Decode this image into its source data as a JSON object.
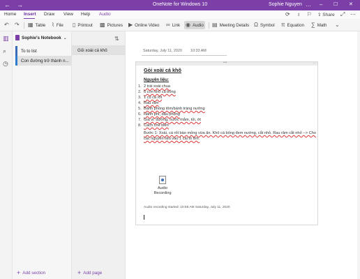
{
  "titlebar": {
    "back": "←",
    "forward": "→",
    "title": "OneNote for Windows 10",
    "user": "Sophie Nguyen",
    "more": "…",
    "minimize": "–",
    "maximize": "☐",
    "close": "✕"
  },
  "menu": {
    "tabs": [
      "Home",
      "Insert",
      "Draw",
      "View",
      "Help",
      "Audio"
    ],
    "active": "Insert",
    "share_label": "Share"
  },
  "ribbon": {
    "undo": "↶",
    "redo": "↷",
    "table": "Table",
    "file": "File",
    "printout": "Printout",
    "pictures": "Pictures",
    "online_video": "Online Video",
    "link": "Link",
    "audio": "Audio",
    "meeting_details": "Meeting Details",
    "symbol": "Symbol",
    "equation": "Equation",
    "math": "Math",
    "more": "⌄"
  },
  "notebook": {
    "name": "Sophie's Notebook",
    "sections": [
      {
        "label": "To to list",
        "color": "#3a6db5"
      },
      {
        "label": "Con đường trở thành n...",
        "color": "#2e7bd0"
      }
    ],
    "add_section": "Add section"
  },
  "pages": {
    "items": [
      "Gỏi xoài cá khô"
    ],
    "add_page": "Add page"
  },
  "page": {
    "date": "Saturday, July 11, 2020",
    "time": "10:33 AM",
    "title": "Gỏi xoài cá khô",
    "ingredients_heading": "Nguyên liệu:",
    "ingredients": [
      {
        "num": "1.",
        "text": "2 trái xoài chua"
      },
      {
        "num": "2.",
        "text": "6 con khô cá bống"
      },
      {
        "num": "3.",
        "text": "1 củ cà rốt"
      },
      {
        "num": "4.",
        "text": "Rau răm"
      },
      {
        "num": "5.",
        "text": "Bánh phồng tôm/bánh tráng nướng"
      },
      {
        "num": "6.",
        "text": "Hành phi, đậu phộng"
      },
      {
        "num": "7.",
        "text": "Gia vị: đường, nước mắm, tỏi, ớt"
      },
      {
        "num": "8.",
        "text": "Cách chế biến"
      }
    ],
    "step1": "Bước 1: Xoài, cà rốt bào mỏng vừa ăn. Khô cá bống đem nướng, cắt nhỏ. Rau răm cắt nhỏ --> Cho các nguyên liệu vào 1 cái tô lớn.",
    "audio_label_1": "Audio",
    "audio_label_2": "Recording",
    "recording_note": "Audio recording started: 10:59 AM Saturday, July 11, 2020"
  }
}
